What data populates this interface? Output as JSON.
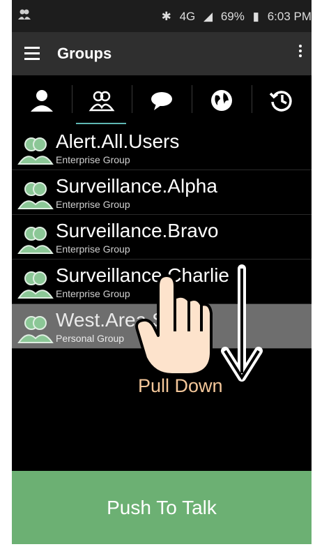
{
  "status_bar": {
    "signal_type": "4G",
    "battery": "69%",
    "time": "6:03 PM"
  },
  "app_bar": {
    "title": "Groups"
  },
  "tabs": [
    {
      "name": "contacts",
      "icon": "person-icon"
    },
    {
      "name": "groups",
      "icon": "group-icon",
      "selected": true
    },
    {
      "name": "messages",
      "icon": "chat-icon"
    },
    {
      "name": "web",
      "icon": "globe-icon"
    },
    {
      "name": "history",
      "icon": "history-icon"
    }
  ],
  "groups": [
    {
      "name": "Alert.All.Users",
      "type": "Enterprise Group"
    },
    {
      "name": "Surveillance.Alpha",
      "type": "Enterprise Group"
    },
    {
      "name": "Surveillance.Bravo",
      "type": "Enterprise Group"
    },
    {
      "name": "Surveillance.Charlie",
      "type": "Enterprise Group"
    },
    {
      "name": "West.Area.Staff",
      "type": "Personal Group",
      "selected": true
    }
  ],
  "gesture_hint": {
    "label": "Pull Down"
  },
  "push_to_talk": {
    "label": "Push To Talk"
  },
  "colors": {
    "accent_underline": "#5fb7b4",
    "ptt_green": "#6cb073",
    "avatar_green": "#8bc796",
    "hint_orange": "#f4c79a"
  }
}
